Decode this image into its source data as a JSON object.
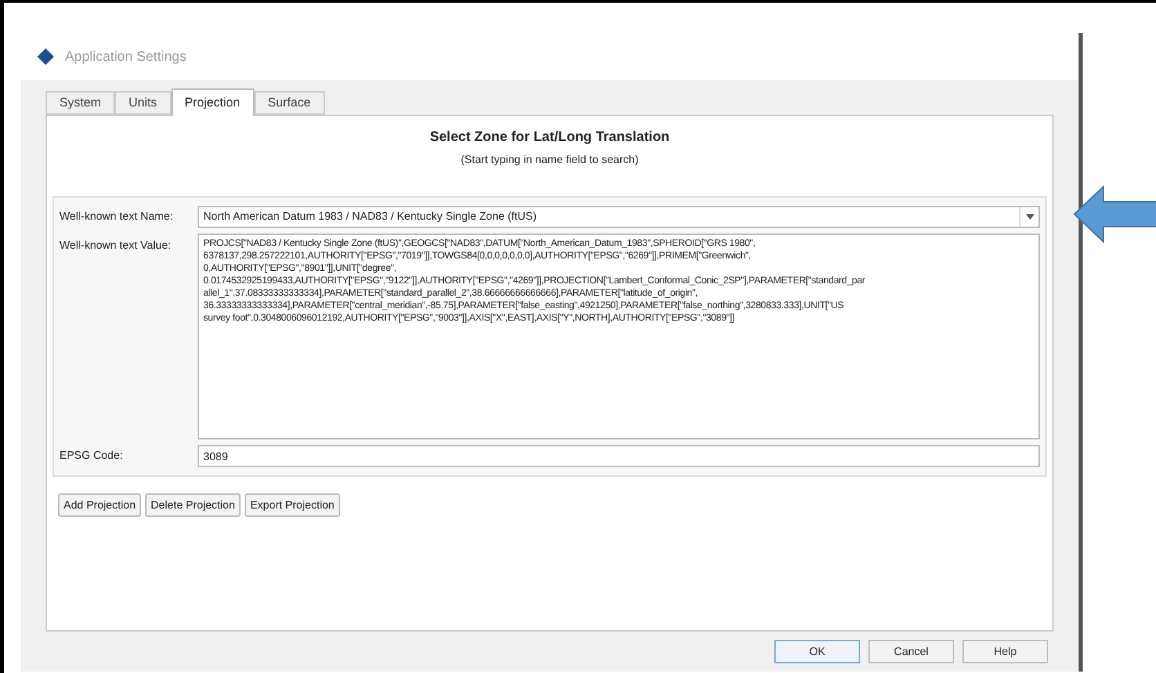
{
  "window": {
    "title": "Application Settings"
  },
  "tabs": [
    {
      "label": "System",
      "selected": false
    },
    {
      "label": "Units",
      "selected": false
    },
    {
      "label": "Projection",
      "selected": true
    },
    {
      "label": "Surface",
      "selected": false
    }
  ],
  "heading": "Select Zone for Lat/Long Translation",
  "subheading": "(Start typing in name field to search)",
  "name_field": {
    "label": "Well-known text Name:",
    "value": "North American Datum 1983 / NAD83 / Kentucky Single Zone (ftUS)"
  },
  "value_field": {
    "label": "Well-known text Value:",
    "lines": [
      "PROJCS[\"NAD83 / Kentucky Single Zone (ftUS)\",GEOGCS[\"NAD83\",DATUM[\"North_American_Datum_1983\",SPHEROID[\"GRS 1980\",",
      "6378137,298.257222101,AUTHORITY[\"EPSG\",\"7019\"]],TOWGS84[0,0,0,0,0,0,0],AUTHORITY[\"EPSG\",\"6269\"]],PRIMEM[\"Greenwich\",",
      "0,AUTHORITY[\"EPSG\",\"8901\"]],UNIT[\"degree\",",
      "0.0174532925199433,AUTHORITY[\"EPSG\",\"9122\"]],AUTHORITY[\"EPSG\",\"4269\"]],PROJECTION[\"Lambert_Conformal_Conic_2SP\"],PARAMETER[\"standard_par",
      "allel_1\",37.08333333333334],PARAMETER[\"standard_parallel_2\",38.66666666666666],PARAMETER[\"latitude_of_origin\",",
      "36.33333333333334],PARAMETER[\"central_meridian\",-85.75],PARAMETER[\"false_easting\",4921250],PARAMETER[\"false_northing\",3280833.333],UNIT[\"US",
      "survey foot\",0.3048006096012192,AUTHORITY[\"EPSG\",\"9003\"]],AXIS[\"X\",EAST],AXIS[\"Y\",NORTH],AUTHORITY[\"EPSG\",\"3089\"]]"
    ]
  },
  "epsg_field": {
    "label": "EPSG Code:",
    "value": "3089"
  },
  "projection_buttons": [
    "Add Projection",
    "Delete Projection",
    "Export Projection"
  ],
  "dialog_buttons": [
    {
      "label": "OK",
      "default": true
    },
    {
      "label": "Cancel",
      "default": false
    },
    {
      "label": "Help",
      "default": false
    }
  ]
}
